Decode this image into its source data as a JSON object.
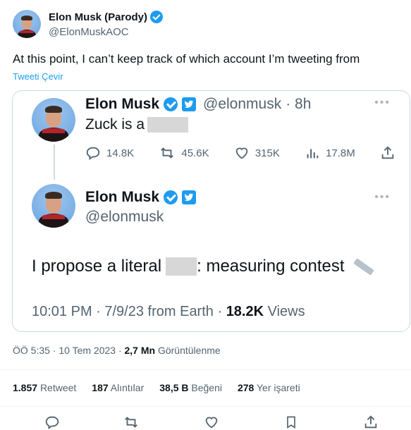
{
  "author": {
    "name": "Elon Musk (Parody)",
    "handle": "@ElonMuskAOC"
  },
  "tweet": {
    "text": "At this point, I can’t keep track of which account I’m tweeting from",
    "translate_label": "Tweeti Çevir"
  },
  "quoted": {
    "first": {
      "name": "Elon Musk",
      "handle": "@elonmusk",
      "time": "· 8h",
      "text": "Zuck is a",
      "stats": {
        "replies": "14.8K",
        "retweets": "45.6K",
        "likes": "315K",
        "views": "17.8M"
      }
    },
    "second": {
      "name": "Elon Musk",
      "handle": "@elonmusk",
      "text_before": "I propose a literal",
      "text_after": ": measuring contest",
      "timestamp": "10:01 PM · 7/9/23 from Earth ·",
      "views_count": "18.2K",
      "views_label": "Views"
    }
  },
  "meta": {
    "time": "ÖÖ 5:35 · 10 Tem 2023 ·",
    "views_count": "2,7 Mn",
    "views_label": "Görüntülenme"
  },
  "stats": [
    {
      "count": "1.857",
      "label": "Retweet"
    },
    {
      "count": "187",
      "label": "Alıntılar"
    },
    {
      "count": "38,5 B",
      "label": "Beğeni"
    },
    {
      "count": "278",
      "label": "Yer işareti"
    }
  ],
  "colors": {
    "accent": "#1d9bf0",
    "secondary_text": "#536471",
    "border": "#cfd9de"
  }
}
